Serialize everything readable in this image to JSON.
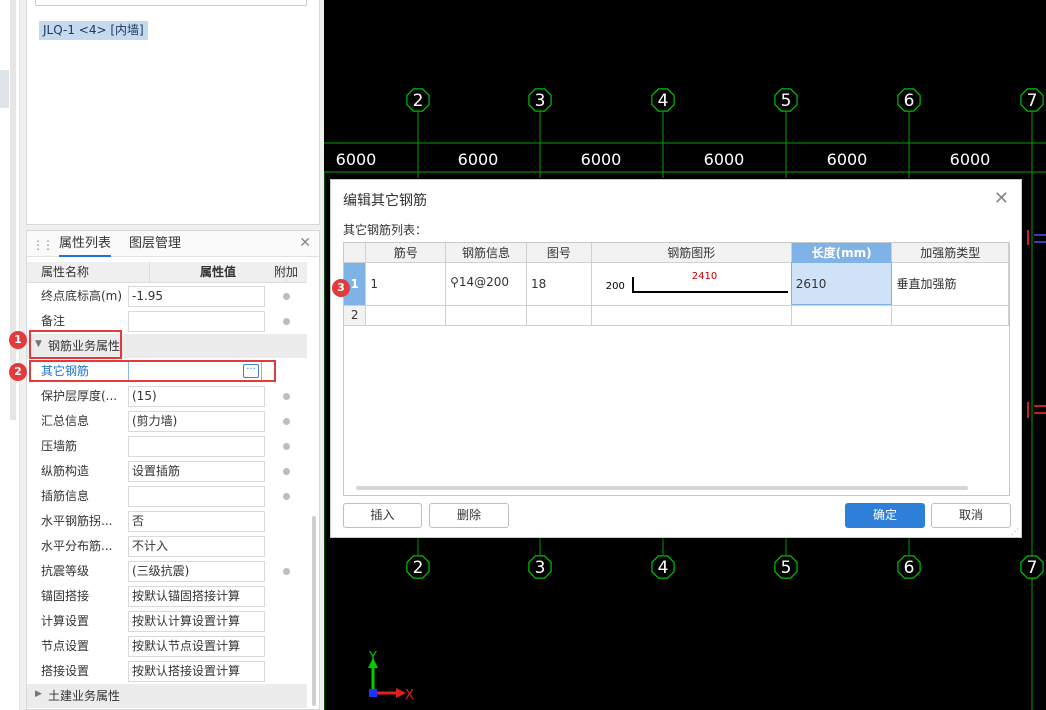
{
  "component_list": {
    "selected_item": "JLQ-1 <4> [内墙]"
  },
  "property_panel": {
    "tabs": [
      "属性列表",
      "图层管理"
    ],
    "header": {
      "name": "属性名称",
      "value": "属性值",
      "extra": "附加"
    },
    "rows_top": [
      {
        "name": "终点底标高(m)",
        "value": "-1.95"
      },
      {
        "name": "备注",
        "value": ""
      }
    ],
    "group_rebar": "钢筋业务属性",
    "selected_row": {
      "name": "其它钢筋",
      "value": ""
    },
    "rows_rebar": [
      {
        "name": "保护层厚度(...",
        "value": "(15)"
      },
      {
        "name": "汇总信息",
        "value": "(剪力墙)"
      },
      {
        "name": "压墙筋",
        "value": ""
      },
      {
        "name": "纵筋构造",
        "value": "设置插筋"
      },
      {
        "name": "插筋信息",
        "value": ""
      },
      {
        "name": "水平钢筋拐...",
        "value": "否"
      },
      {
        "name": "水平分布筋...",
        "value": "不计入"
      },
      {
        "name": "抗震等级",
        "value": "(三级抗震)"
      },
      {
        "name": "锚固搭接",
        "value": "按默认锚固搭接计算"
      },
      {
        "name": "计算设置",
        "value": "按默认计算设置计算"
      },
      {
        "name": "节点设置",
        "value": "按默认节点设置计算"
      },
      {
        "name": "搭接设置",
        "value": "按默认搭接设置计算"
      }
    ],
    "group_civil": "土建业务属性"
  },
  "markers": [
    "1",
    "2",
    "3"
  ],
  "cad": {
    "axes": [
      "2",
      "3",
      "4",
      "5",
      "6",
      "7"
    ],
    "spans": [
      "6000",
      "6000",
      "6000",
      "6000",
      "6000",
      "6000"
    ],
    "ucs": {
      "y": "Y",
      "x": "X"
    },
    "colors": {
      "grid": "#00a000",
      "bubble": "#00c000",
      "text": "#ffffff",
      "wall": "#d02020"
    }
  },
  "dialog": {
    "title": "编辑其它钢筋",
    "subtitle": "其它钢筋列表：",
    "columns": [
      "筋号",
      "钢筋信息",
      "图号",
      "钢筋图形",
      "长度(mm)",
      "加强筋类型"
    ],
    "rows": [
      {
        "num": "1",
        "bar_no": "1",
        "bar_info": "⚲14@200",
        "figure_no": "18",
        "shape_left": "200",
        "shape_top": "2410",
        "length": "2610",
        "type": "垂直加强筋"
      },
      {
        "num": "2",
        "bar_no": "",
        "bar_info": "",
        "figure_no": "",
        "length": "",
        "type": ""
      }
    ],
    "buttons": {
      "insert": "插入",
      "delete": "删除",
      "ok": "确定",
      "cancel": "取消"
    }
  }
}
